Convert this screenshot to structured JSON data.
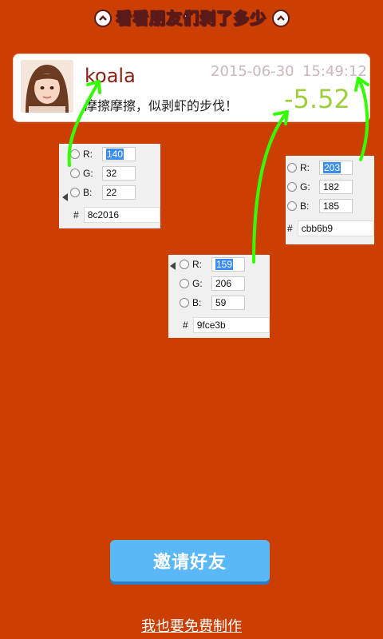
{
  "colors": {
    "background": "#cc3f02",
    "name": "#8c2016",
    "amount": "#9fce3b",
    "timestamp": "#cbb6b9",
    "arrow": "#33ff00",
    "button": "#5bb8f7"
  },
  "banner": {
    "title": "看看朋友们剥了多少",
    "icon": "chevron-up-icon"
  },
  "card": {
    "name": "koala",
    "date": "2015-06-30",
    "time": "15:49:12",
    "message": "摩擦摩擦，似剥虾的步伐！",
    "amount": "-5.52"
  },
  "pickers": [
    {
      "r_label": "R:",
      "g_label": "G:",
      "b_label": "B:",
      "r": "140",
      "g": "32",
      "b": "22",
      "hex": "8c2016",
      "hash": "#"
    },
    {
      "r_label": "R:",
      "g_label": "G:",
      "b_label": "B:",
      "r": "203",
      "g": "182",
      "b": "185",
      "hex": "cbb6b9",
      "hash": "#"
    },
    {
      "r_label": "R:",
      "g_label": "G:",
      "b_label": "B:",
      "r": "159",
      "g": "206",
      "b": "59",
      "hex": "9fce3b",
      "hash": "#"
    }
  ],
  "buttons": {
    "invite": "邀请好友",
    "make": "我也要免费制作"
  }
}
